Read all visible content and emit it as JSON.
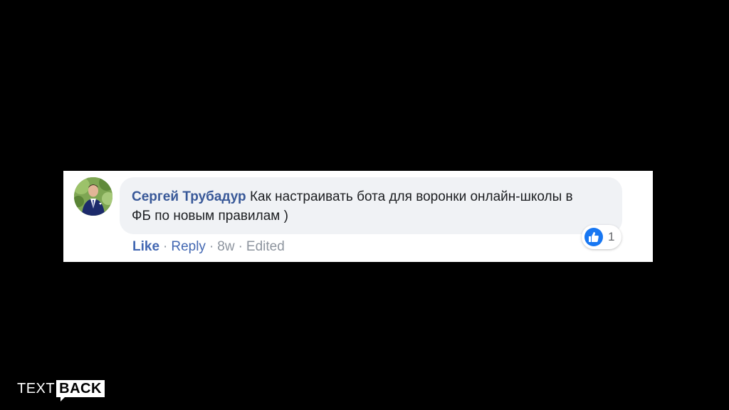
{
  "comment": {
    "author": "Сергей Трубадур",
    "text": "Как настраивать бота для воронки онлайн-школы в ФБ по новым правилам )"
  },
  "reactions": {
    "icon": "thumbs-up-icon",
    "count": "1"
  },
  "actions": {
    "like_label": "Like",
    "reply_label": "Reply",
    "time": "8w",
    "edited": "Edited",
    "separator": "·"
  },
  "logo": {
    "text": "TEXT",
    "back": "BACK"
  },
  "colors": {
    "background": "#000000",
    "author": "#385898",
    "link": "#4267b2",
    "bubble": "#f0f2f5",
    "like_blue": "#1877f2"
  }
}
